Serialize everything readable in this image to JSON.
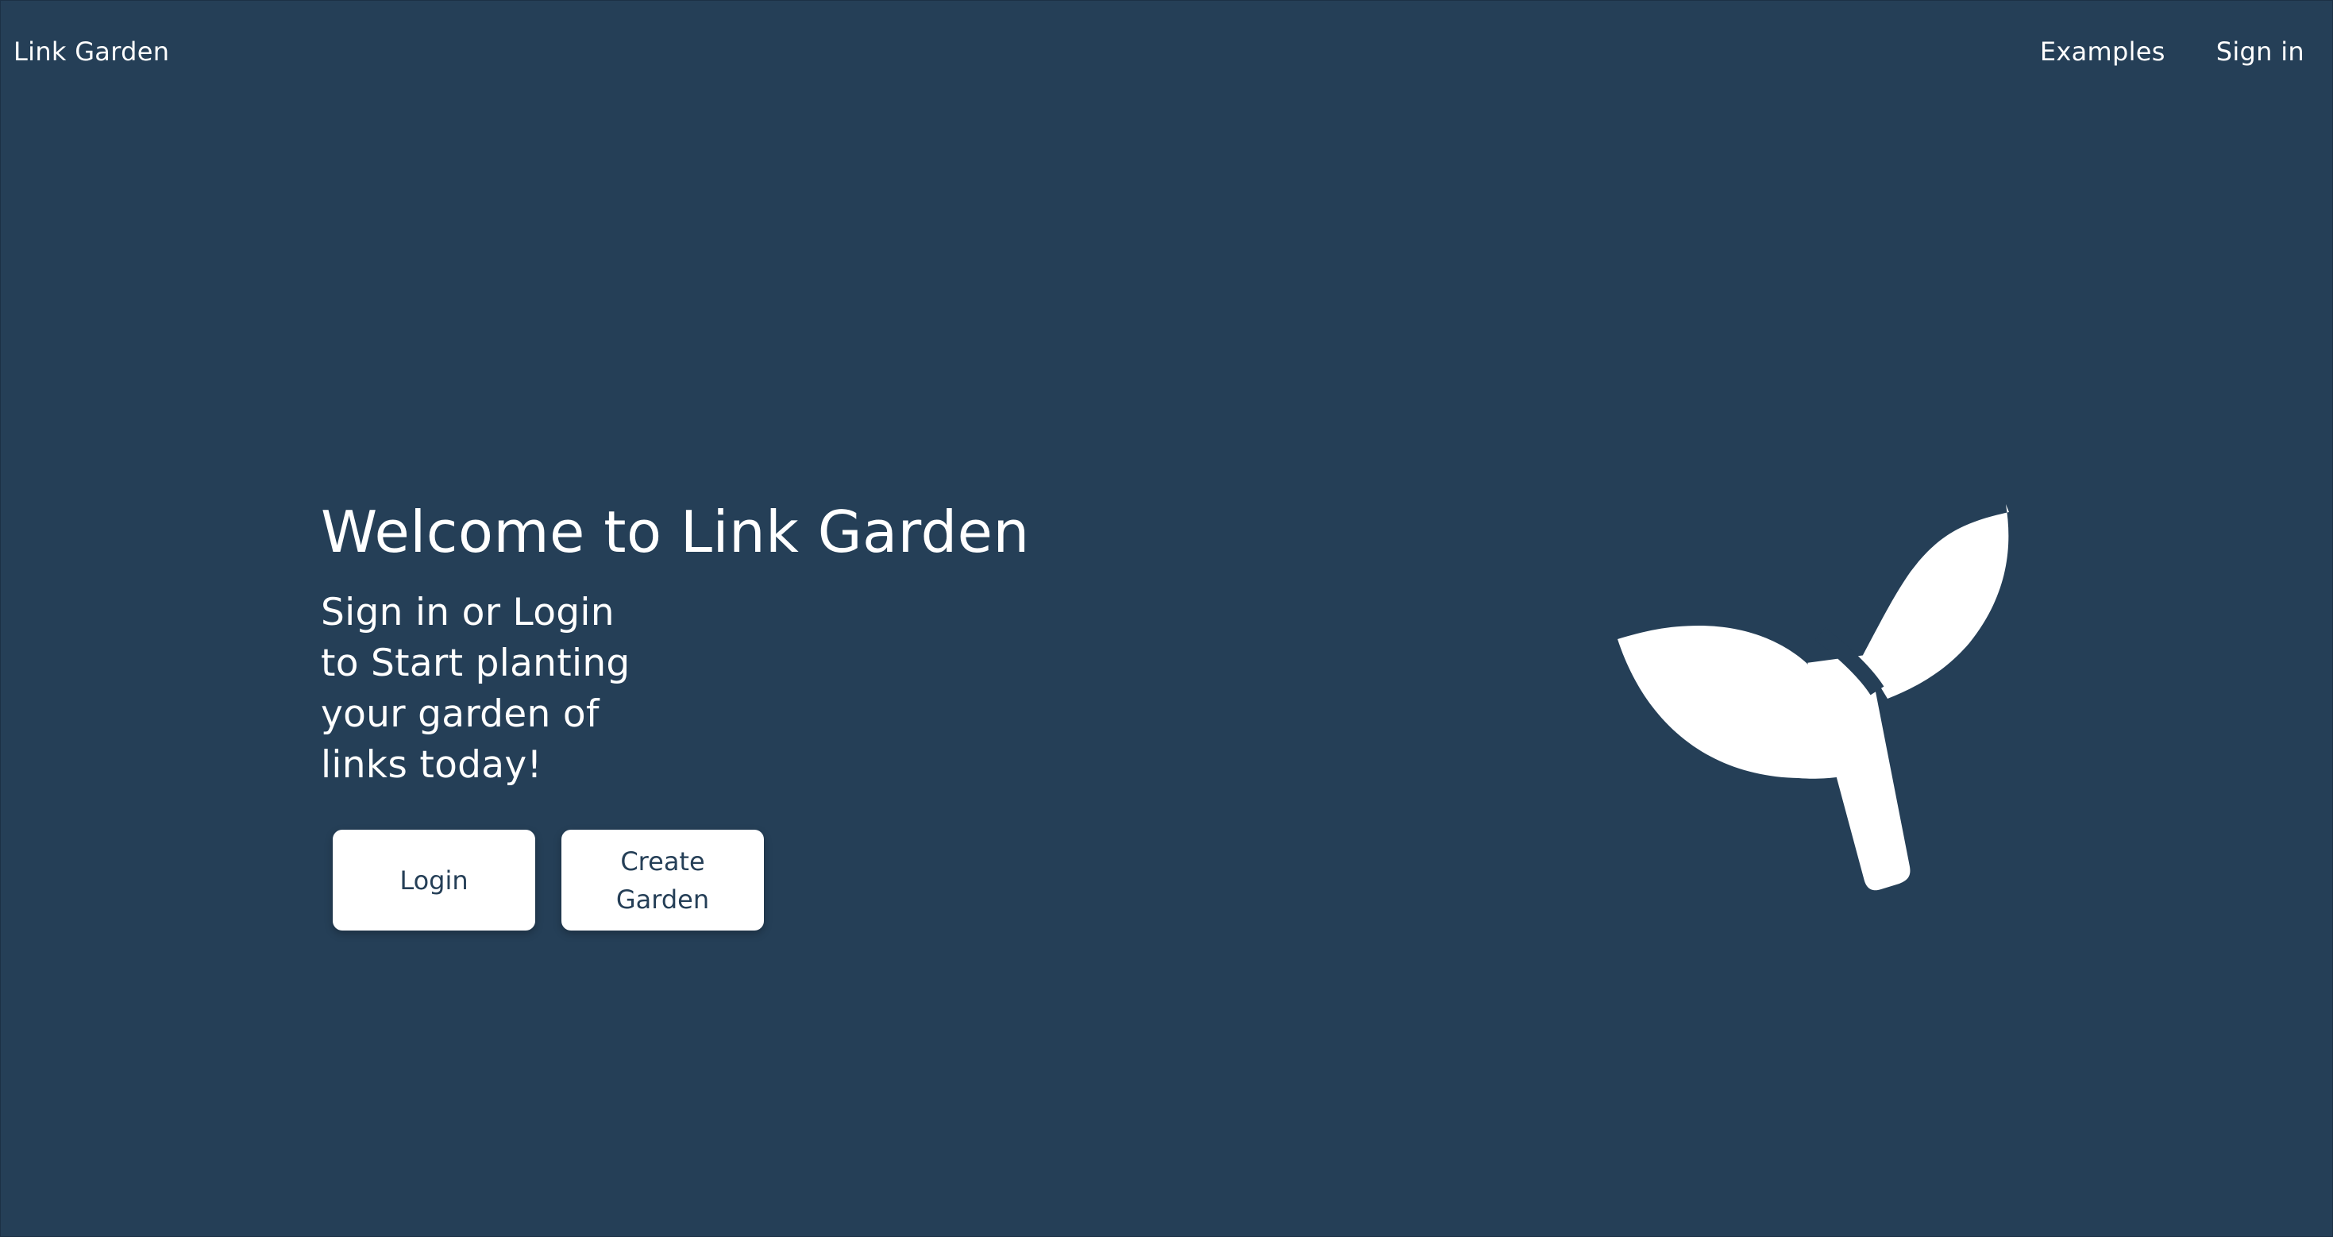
{
  "navbar": {
    "brand": "Link Garden",
    "links": [
      "Examples",
      "Sign in"
    ]
  },
  "hero": {
    "title": "Welcome to Link Garden",
    "subtitle_lines": [
      "Sign in or Login",
      "to Start planting",
      "your garden of",
      "links today!"
    ],
    "login_button": "Login",
    "create_button": "Create Garden"
  },
  "illustration": {
    "icon": "sprout-icon"
  },
  "colors": {
    "background": "#253f57",
    "foreground": "#ffffff",
    "button_text": "#253f57"
  }
}
